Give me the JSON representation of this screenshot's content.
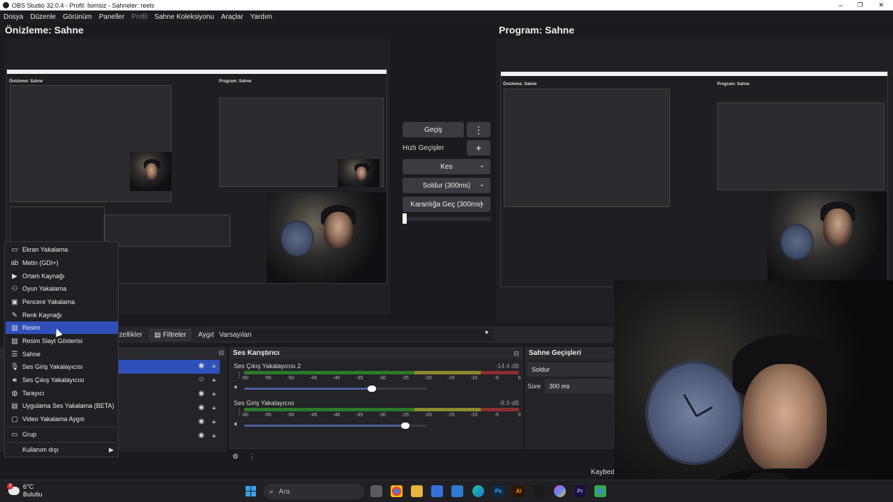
{
  "window": {
    "title": "OBS Studio 32.0.4 - Profil: İsimsiz - Sahneler: reels",
    "minimize": "─",
    "maximize": "❐",
    "close": "✕"
  },
  "menu": [
    "Dosya",
    "Düzenle",
    "Görünüm",
    "Paneller",
    "Profil",
    "Sahne Koleksiyonu",
    "Araçlar",
    "Yardım"
  ],
  "preview": {
    "title": "Önizleme: Sahne"
  },
  "program": {
    "title": "Program: Sahne"
  },
  "nested": {
    "preview_label": "Önizleme: Sahne",
    "program_label": "Program: Sahne"
  },
  "transitions": {
    "transition_button": "Geçiş",
    "more_icon": "⋮",
    "quick_label": "Hızlı Geçişler",
    "add_icon": "+",
    "quick_items": [
      "Kes",
      "Soldur (300ms)",
      "Karanlığa Geç (300ms)"
    ],
    "t_bar_level": 0
  },
  "toolbar": {
    "properties": "Özellikler",
    "filters": "Filtreler",
    "device_label": "Aygıt",
    "device_value": "Varsayılan"
  },
  "sources_dock": {
    "rows": [
      {
        "selected": true,
        "visible": true
      },
      {
        "selected": false,
        "visible": false
      },
      {
        "selected": false,
        "visible": true
      },
      {
        "selected": false,
        "visible": true
      },
      {
        "selected": false,
        "visible": true
      },
      {
        "selected": false,
        "visible": true
      }
    ]
  },
  "mixer": {
    "title": "Ses Karıştırıcı",
    "channels": [
      {
        "name": "Ses Çıkış Yakalayıcısı 2",
        "db": "-14.4 dB",
        "volume": 0.7
      },
      {
        "name": "Ses Giriş Yakalayıcısı",
        "db": "-8.9 dB",
        "volume": 0.88
      }
    ],
    "scale": [
      "-60",
      "-55",
      "-50",
      "-45",
      "-40",
      "-35",
      "-30",
      "-25",
      "-20",
      "-15",
      "-10",
      "-5",
      "0"
    ]
  },
  "scene_transitions": {
    "title": "Sahne Geçişleri",
    "selected": "Soldur",
    "duration_label": "Süre",
    "duration_value": "300 ms"
  },
  "context_menu": {
    "items": [
      {
        "label": "Ekran Yakalama",
        "icon": "monitor-icon"
      },
      {
        "label": "Metin (GDI+)",
        "icon": "text-icon"
      },
      {
        "label": "Ortam Kaynağı",
        "icon": "play-icon"
      },
      {
        "label": "Oyun Yakalama",
        "icon": "gamepad-icon"
      },
      {
        "label": "Pencere Yakalama",
        "icon": "window-icon"
      },
      {
        "label": "Renk Kaynağı",
        "icon": "brush-icon"
      },
      {
        "label": "Resim",
        "icon": "image-icon"
      },
      {
        "label": "Resim Slayt Gösterisi",
        "icon": "slideshow-icon"
      },
      {
        "label": "Sahne",
        "icon": "list-icon"
      },
      {
        "label": "Ses Giriş Yakalayıcısı",
        "icon": "microphone-icon"
      },
      {
        "label": "Ses Çıkış Yakalayıcısı",
        "icon": "speaker-icon"
      },
      {
        "label": "Tarayıcı",
        "icon": "globe-icon"
      },
      {
        "label": "Uygulama Ses Yakalama (BETA)",
        "icon": "app-audio-icon"
      },
      {
        "label": "Video Yakalama Aygıtı",
        "icon": "camera-icon"
      },
      {
        "label": "Grup",
        "icon": "folder-icon"
      },
      {
        "label": "Kullanım dışı",
        "icon": ""
      }
    ],
    "highlighted": "Resim"
  },
  "status": {
    "recording_text": "Kaybedi"
  },
  "taskbar": {
    "weather_temp": "6°C",
    "weather_desc": "Bulutlu",
    "weather_badge": "3",
    "search_placeholder": "Ara",
    "apps": [
      "Ps",
      "Ai",
      "Pr"
    ]
  },
  "colors": {
    "accent": "#2f50b8",
    "panel_bg": "#1b1b1f",
    "meter_green": "#2c7a2a",
    "meter_yellow": "#8b8a2c",
    "meter_red": "#8a2f2f"
  }
}
